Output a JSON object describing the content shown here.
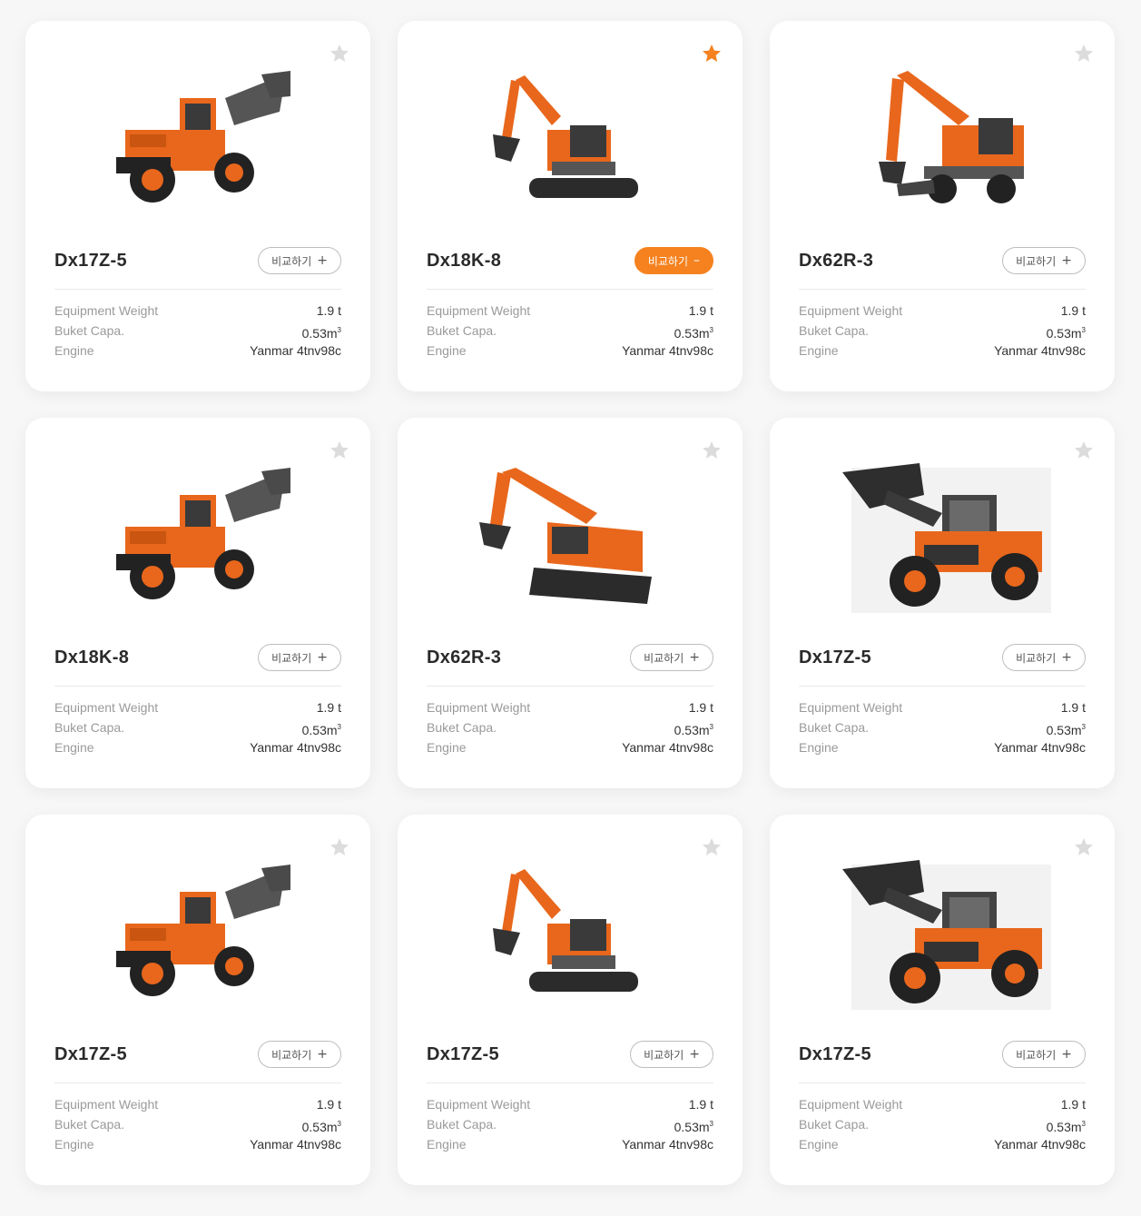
{
  "cards": [
    {
      "model": "Dx17Z-5",
      "image": "wheel-loader-compact",
      "favorite": false,
      "compare_label": "비교하기",
      "compare_symbol": "+",
      "compare_active": false,
      "specs": [
        {
          "label": "Equipment Weight",
          "value": "1.9 t"
        },
        {
          "label": "Buket Capa.",
          "value": "0.53m",
          "sup": "3"
        },
        {
          "label": "Engine",
          "value": "Yanmar 4tnv98c"
        }
      ]
    },
    {
      "model": "Dx18K-8",
      "image": "excavator-crawler",
      "favorite": true,
      "compare_label": "비교하기",
      "compare_symbol": "–",
      "compare_active": true,
      "specs": [
        {
          "label": "Equipment Weight",
          "value": "1.9 t"
        },
        {
          "label": "Buket Capa.",
          "value": "0.53m",
          "sup": "3"
        },
        {
          "label": "Engine",
          "value": "Yanmar 4tnv98c"
        }
      ]
    },
    {
      "model": "Dx62R-3",
      "image": "excavator-wheeled",
      "favorite": false,
      "compare_label": "비교하기",
      "compare_symbol": "+",
      "compare_active": false,
      "specs": [
        {
          "label": "Equipment Weight",
          "value": "1.9 t"
        },
        {
          "label": "Buket Capa.",
          "value": "0.53m",
          "sup": "3"
        },
        {
          "label": "Engine",
          "value": "Yanmar 4tnv98c"
        }
      ]
    },
    {
      "model": "Dx18K-8",
      "image": "wheel-loader-compact",
      "favorite": false,
      "compare_label": "비교하기",
      "compare_symbol": "+",
      "compare_active": false,
      "specs": [
        {
          "label": "Equipment Weight",
          "value": "1.9 t"
        },
        {
          "label": "Buket Capa.",
          "value": "0.53m",
          "sup": "3"
        },
        {
          "label": "Engine",
          "value": "Yanmar 4tnv98c"
        }
      ]
    },
    {
      "model": "Dx62R-3",
      "image": "excavator-large",
      "favorite": false,
      "compare_label": "비교하기",
      "compare_symbol": "+",
      "compare_active": false,
      "specs": [
        {
          "label": "Equipment Weight",
          "value": "1.9 t"
        },
        {
          "label": "Buket Capa.",
          "value": "0.53m",
          "sup": "3"
        },
        {
          "label": "Engine",
          "value": "Yanmar 4tnv98c"
        }
      ]
    },
    {
      "model": "Dx17Z-5",
      "image": "wheel-loader-large",
      "favorite": false,
      "compare_label": "비교하기",
      "compare_symbol": "+",
      "compare_active": false,
      "specs": [
        {
          "label": "Equipment Weight",
          "value": "1.9 t"
        },
        {
          "label": "Buket Capa.",
          "value": "0.53m",
          "sup": "3"
        },
        {
          "label": "Engine",
          "value": "Yanmar 4tnv98c"
        }
      ]
    },
    {
      "model": "Dx17Z-5",
      "image": "wheel-loader-compact",
      "favorite": false,
      "compare_label": "비교하기",
      "compare_symbol": "+",
      "compare_active": false,
      "specs": [
        {
          "label": "Equipment Weight",
          "value": "1.9 t"
        },
        {
          "label": "Buket Capa.",
          "value": "0.53m",
          "sup": "3"
        },
        {
          "label": "Engine",
          "value": "Yanmar 4tnv98c"
        }
      ]
    },
    {
      "model": "Dx17Z-5",
      "image": "excavator-crawler",
      "favorite": false,
      "compare_label": "비교하기",
      "compare_symbol": "+",
      "compare_active": false,
      "specs": [
        {
          "label": "Equipment Weight",
          "value": "1.9 t"
        },
        {
          "label": "Buket Capa.",
          "value": "0.53m",
          "sup": "3"
        },
        {
          "label": "Engine",
          "value": "Yanmar 4tnv98c"
        }
      ]
    },
    {
      "model": "Dx17Z-5",
      "image": "wheel-loader-large",
      "favorite": false,
      "compare_label": "비교하기",
      "compare_symbol": "+",
      "compare_active": false,
      "specs": [
        {
          "label": "Equipment Weight",
          "value": "1.9 t"
        },
        {
          "label": "Buket Capa.",
          "value": "0.53m",
          "sup": "3"
        },
        {
          "label": "Engine",
          "value": "Yanmar 4tnv98c"
        }
      ]
    }
  ],
  "colors": {
    "accent": "#f5821f",
    "star_inactive": "#dcdcdc",
    "machine_orange": "#e8671c",
    "machine_dark": "#2b2b2b"
  }
}
